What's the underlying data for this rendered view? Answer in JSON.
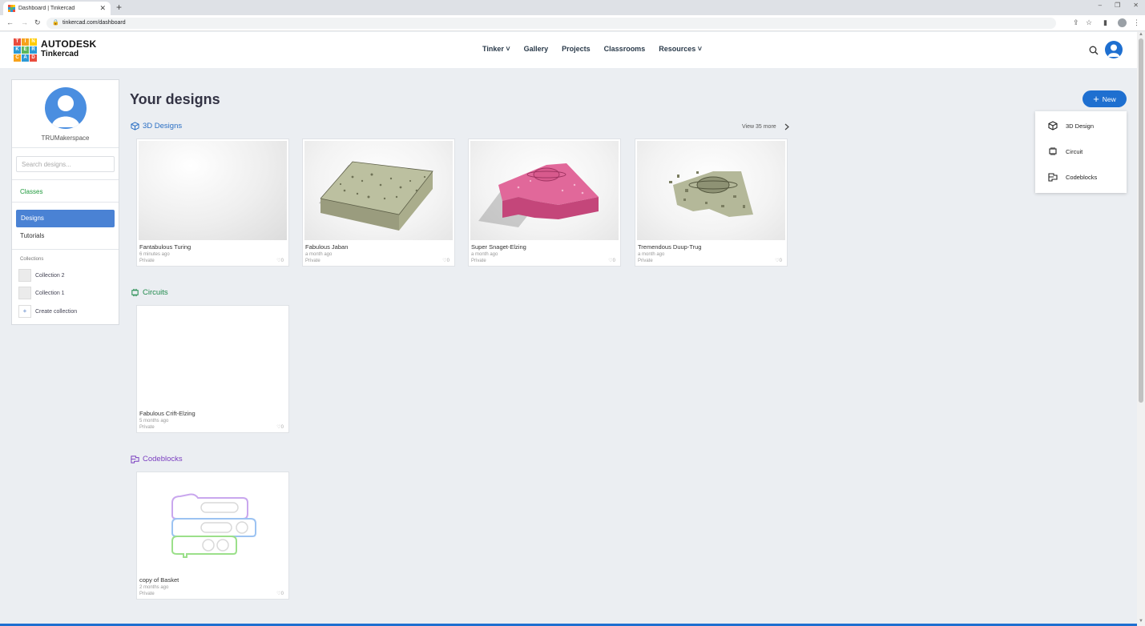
{
  "browser": {
    "tab_title": "Dashboard | Tinkercad",
    "tab_close": "✕",
    "new_tab": "+",
    "url": "tinkercad.com/dashboard",
    "window_controls": [
      "–",
      "❐",
      "✕"
    ]
  },
  "header": {
    "logo_letters": [
      "T",
      "I",
      "N",
      "K",
      "E",
      "R",
      "C",
      "A",
      "D"
    ],
    "logo_colors": [
      "#e94c3d",
      "#f7a21b",
      "#ffcd05",
      "#2d9ad5",
      "#5cb85c",
      "#2d9ad5",
      "#f7a21b",
      "#2d9ad5",
      "#e94c3d"
    ],
    "brand_line1": "AUTODESK",
    "brand_line2": "Tinkercad",
    "nav": [
      "Tinker ˅",
      "Gallery",
      "Projects",
      "Classrooms",
      "Resources ˅"
    ]
  },
  "sidebar": {
    "username": "TRUMakerspace",
    "search_placeholder": "Search designs...",
    "classes": "Classes",
    "designs": "Designs",
    "tutorials": "Tutorials",
    "collections_header": "Collections",
    "collections": [
      "Collection 2",
      "Collection 1"
    ],
    "create_collection": "Create collection",
    "create_icon": "+"
  },
  "main": {
    "title": "Your designs",
    "sections": {
      "designs3d": {
        "label": "3D Designs",
        "view_more": "View 35 more",
        "cards": [
          {
            "name": "Fantabulous Turing",
            "time": "6 minutes ago",
            "privacy": "Private",
            "likes": "♡0"
          },
          {
            "name": "Fabulous Jaban",
            "time": "a month ago",
            "privacy": "Private",
            "likes": "♡0"
          },
          {
            "name": "Super Snaget-Elzing",
            "time": "a month ago",
            "privacy": "Private",
            "likes": "♡0"
          },
          {
            "name": "Tremendous Duup-Trug",
            "time": "a month ago",
            "privacy": "Private",
            "likes": "♡0"
          }
        ]
      },
      "circuits": {
        "label": "Circuits",
        "cards": [
          {
            "name": "Fabulous Crift-Elzing",
            "time": "5 months ago",
            "privacy": "Private",
            "likes": "♡0"
          }
        ]
      },
      "codeblocks": {
        "label": "Codeblocks",
        "cards": [
          {
            "name": "copy of Basket",
            "time": "2 months ago",
            "privacy": "Private",
            "likes": "♡0"
          }
        ]
      }
    }
  },
  "new_menu": {
    "button": "New",
    "button_icon": "+",
    "items": [
      "3D Design",
      "Circuit",
      "Codeblocks"
    ]
  },
  "colors": {
    "accent": "#1e6fd0",
    "sidebar_selected": "#4a82d4",
    "classes_green": "#1f9a3c",
    "circuits_green": "#1f8a4c",
    "codeblocks_purple": "#7b3fc0"
  }
}
